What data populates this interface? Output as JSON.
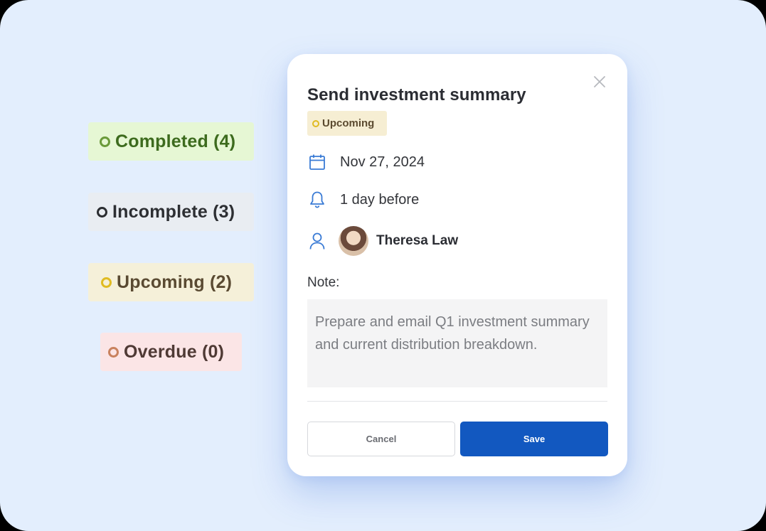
{
  "status_filters": [
    {
      "label": "Completed (4)",
      "ring_color": "#6a9a3a"
    },
    {
      "label": "Incomplete (3)",
      "ring_color": "#2b2d31"
    },
    {
      "label": "Upcoming (2)",
      "ring_color": "#e0bb22"
    },
    {
      "label": "Overdue (0)",
      "ring_color": "#c9825e"
    }
  ],
  "modal": {
    "title": "Send investment summary",
    "status_badge": "Upcoming",
    "due_date": "Nov 27, 2024",
    "reminder": "1 day before",
    "assignee": "Theresa Law",
    "note_label": "Note:",
    "note_text": "Prepare and email Q1 investment summary and current distribution breakdown.",
    "cancel_label": "Cancel",
    "save_label": "Save",
    "icons": [
      "close-icon",
      "calendar-icon",
      "bell-icon",
      "user-icon"
    ]
  },
  "colors": {
    "background": "#e3eefd",
    "accent": "#1258c0",
    "icon": "#3a7bd5"
  }
}
